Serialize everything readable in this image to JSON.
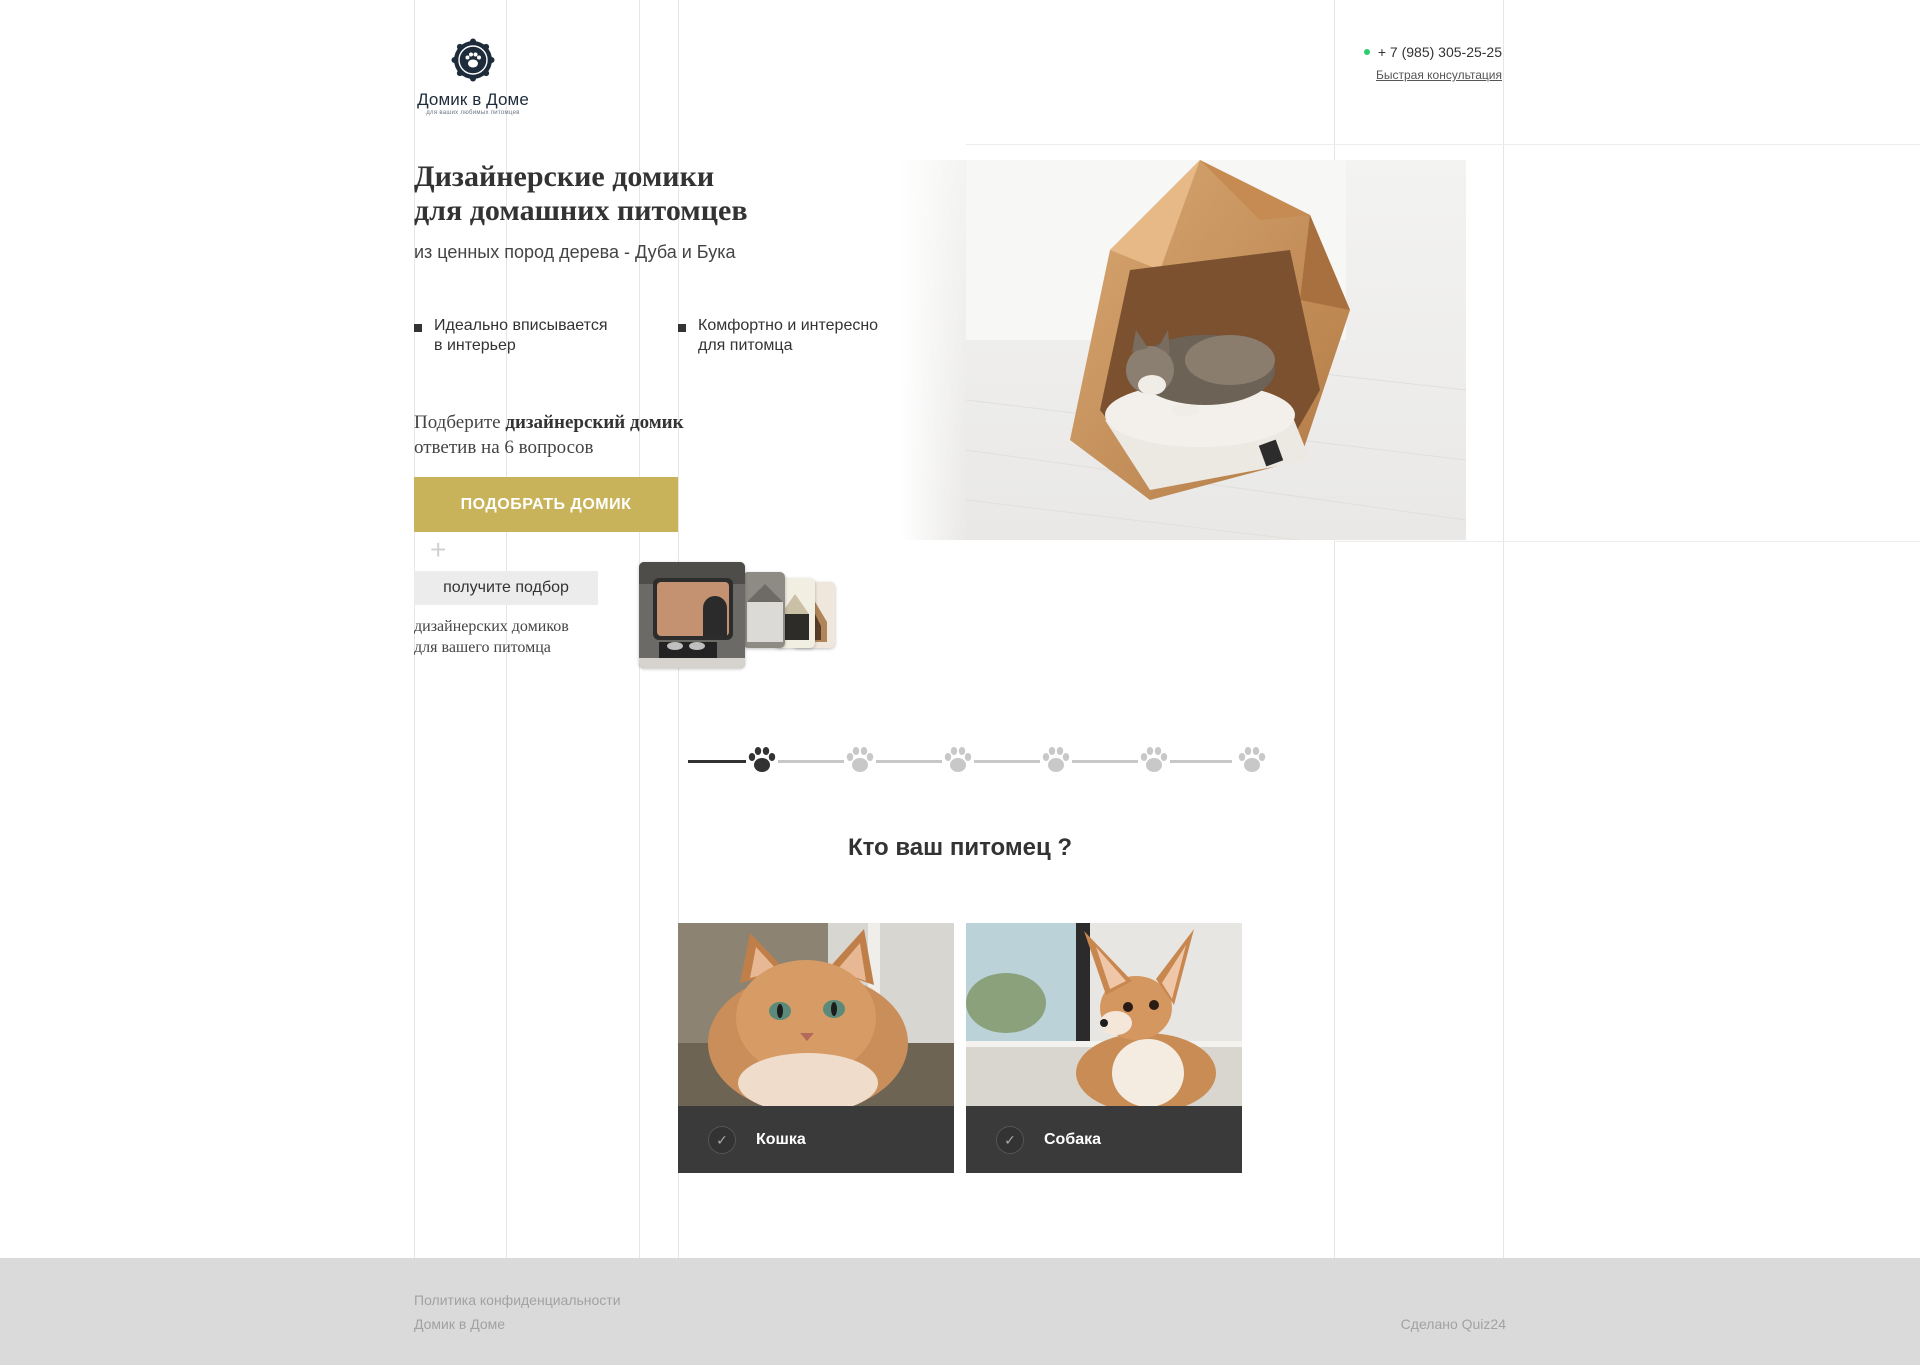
{
  "header": {
    "logo_name": "Домик в Доме",
    "logo_subtitle": "для ваших любимых питомцев",
    "logo_icon": "paw-badge-icon",
    "phone": "+ 7 (985) 305-25-25",
    "consult_link": "Быстрая консультация"
  },
  "hero": {
    "title_line1": "Дизайнерские домики",
    "title_line2": "для домашних питомцев",
    "subtitle": "из ценных пород дерева - Дуба и Бука",
    "features": [
      {
        "line1": "Идеально вписывается",
        "line2": "в интерьер"
      },
      {
        "line1": "Комфортно и интересно",
        "line2": "для питомца"
      }
    ],
    "quiz_intro_prefix": "Подберите ",
    "quiz_intro_bold": "дизайнерский домик",
    "quiz_intro_line2": "ответив на 6 вопросов",
    "cta_label": "ПОДОБРАТЬ ДОМИК",
    "bonus_tag": "получите подбор",
    "bonus_line1": "дизайнерских домиков",
    "bonus_line2": "для вашего питомца"
  },
  "quiz": {
    "total_steps": 6,
    "current_step": 1,
    "question": "Кто ваш питомец ?",
    "options": [
      {
        "label": "Кошка",
        "check": "✓"
      },
      {
        "label": "Собака",
        "check": "✓"
      }
    ]
  },
  "footer": {
    "privacy": "Политика конфиденциальности",
    "brand": "Домик в Доме",
    "made_by": "Сделано Quiz24"
  },
  "colors": {
    "accent": "#c8b35a",
    "dark": "#3a3a3a",
    "online": "#2ecc71",
    "footer_bg": "#dadada"
  }
}
